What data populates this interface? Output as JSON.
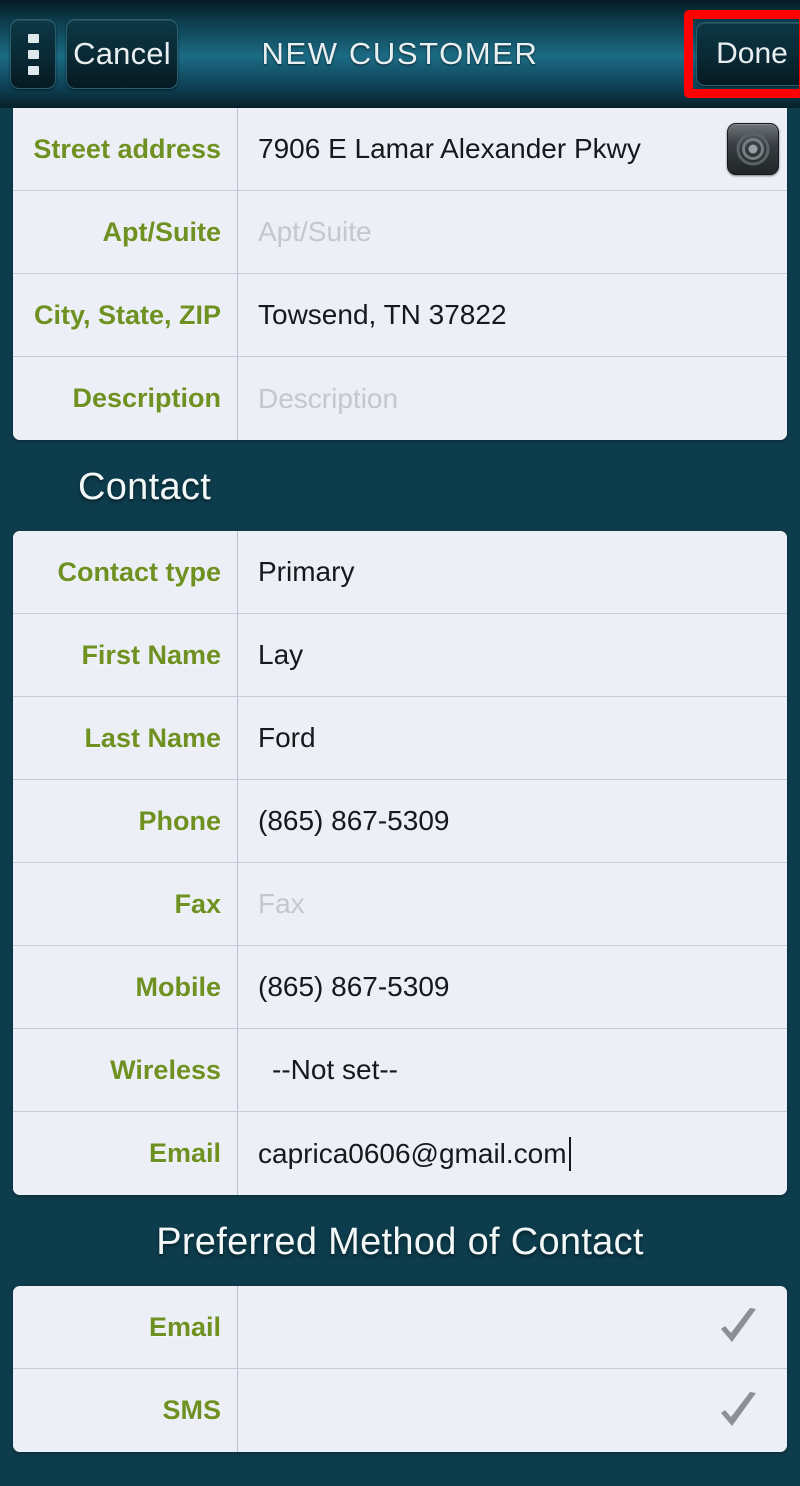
{
  "header": {
    "menu_icon": "overflow-menu-icon",
    "cancel_label": "Cancel",
    "title": "NEW CUSTOMER",
    "done_label": "Done",
    "annotation_color": "#ff0000"
  },
  "colors": {
    "background": "#0d3c4c",
    "card": "#eceff5",
    "label_green": "#6f9122",
    "value_text": "#16181c",
    "placeholder": "#c3c7d0",
    "checkmark_gray": "#8c9096"
  },
  "address_section": {
    "rows": [
      {
        "label": "Street address",
        "value": "7906 E Lamar Alexander Pkwy",
        "placeholder": "",
        "is_placeholder": false,
        "has_locate_button": true
      },
      {
        "label": "Apt/Suite",
        "value": "Apt/Suite",
        "placeholder": "Apt/Suite",
        "is_placeholder": true,
        "has_locate_button": false
      },
      {
        "label": "City, State, ZIP",
        "value": "Towsend, TN 37822",
        "placeholder": "",
        "is_placeholder": false,
        "has_locate_button": false
      },
      {
        "label": "Description",
        "value": "Description",
        "placeholder": "Description",
        "is_placeholder": true,
        "has_locate_button": false
      }
    ]
  },
  "contact_section": {
    "title": "Contact",
    "rows": [
      {
        "label": "Contact type",
        "value": "Primary",
        "is_placeholder": false,
        "indented": false,
        "has_caret": false
      },
      {
        "label": "First Name",
        "value": "Lay",
        "is_placeholder": false,
        "indented": false,
        "has_caret": false
      },
      {
        "label": "Last Name",
        "value": "Ford",
        "is_placeholder": false,
        "indented": false,
        "has_caret": false
      },
      {
        "label": "Phone",
        "value": "(865) 867-5309",
        "is_placeholder": false,
        "indented": false,
        "has_caret": false
      },
      {
        "label": "Fax",
        "value": "Fax",
        "is_placeholder": true,
        "indented": false,
        "has_caret": false
      },
      {
        "label": "Mobile",
        "value": "(865) 867-5309",
        "is_placeholder": false,
        "indented": false,
        "has_caret": false
      },
      {
        "label": "Wireless",
        "value": "--Not set--",
        "is_placeholder": false,
        "indented": true,
        "has_caret": false
      },
      {
        "label": "Email",
        "value": "caprica0606@gmail.com",
        "is_placeholder": false,
        "indented": false,
        "has_caret": true
      }
    ]
  },
  "preferred_section": {
    "title": "Preferred Method of Contact",
    "rows": [
      {
        "label": "Email",
        "value": "",
        "checked": true
      },
      {
        "label": "SMS",
        "value": "",
        "checked": true
      }
    ]
  }
}
